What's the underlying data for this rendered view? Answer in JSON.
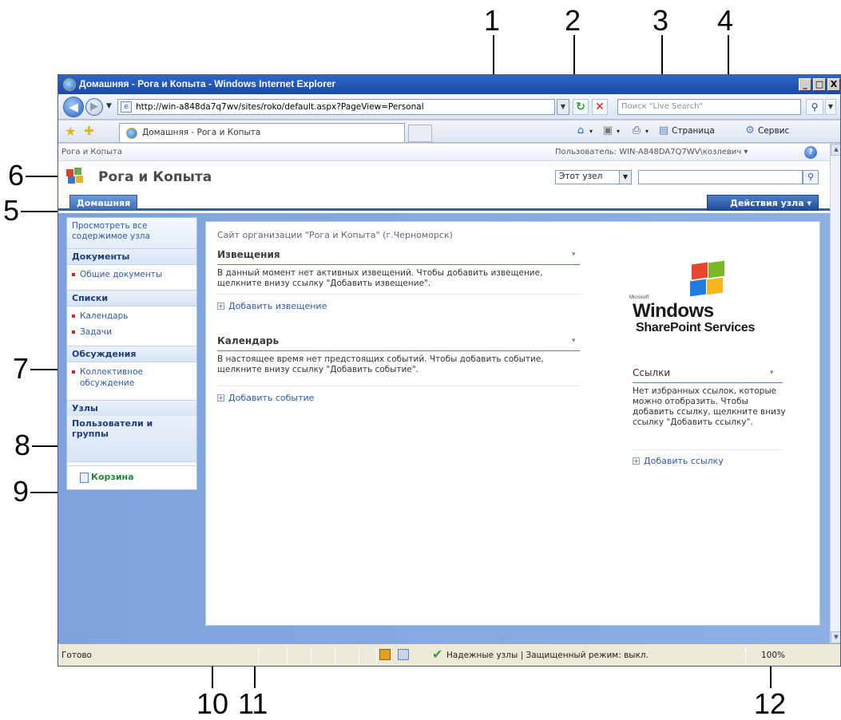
{
  "callouts": [
    "1",
    "2",
    "3",
    "4",
    "5",
    "6",
    "7",
    "8",
    "9",
    "10",
    "11",
    "12"
  ],
  "window": {
    "title": "Домашняя - Рога и Копыта - Windows Internet Explorer",
    "min_label": "_",
    "max_label": "□",
    "close_label": "X"
  },
  "address": {
    "url": "http://win-a848da7q7wv/sites/roko/default.aspx?PageView=Personal",
    "search_placeholder": "Поиск \"Live Search\""
  },
  "tabs": {
    "active_tab": "Домашняя - Рога и Копыта"
  },
  "commands": {
    "page": "Страница",
    "tools": "Сервис"
  },
  "sharepoint": {
    "breadcrumb": "Рога и Копыта",
    "user_label": "Пользователь: WIN-A848DA7Q7WV\\козлевич ▾",
    "site_title": "Рога и Копыта",
    "scope": "Этот узел",
    "home_tab": "Домашняя",
    "site_actions": "Действия узла ▾"
  },
  "quicklaunch": {
    "view_all": "Просмотреть все содержимое узла",
    "documents_header": "Документы",
    "shared_docs": "Общие документы",
    "lists_header": "Списки",
    "calendar": "Календарь",
    "tasks": "Задачи",
    "discussions_header": "Обсуждения",
    "team_discussion": "Коллективное обсуждение",
    "sites_header": "Узлы",
    "people_header": "Пользователи и группы",
    "recycle_bin": "Корзина"
  },
  "main": {
    "site_description": "Сайт организации \"Рога и Копыта\" (г.Черноморск)",
    "announcements": {
      "title": "Извещения",
      "body": "В данный момент нет активных извещений. Чтобы добавить извещение, щелкните внизу ссылку \"Добавить извещение\".",
      "add_link": "Добавить извещение"
    },
    "calendar": {
      "title": "Календарь",
      "body": "В настоящее время нет предстоящих событий. Чтобы добавить событие, щелкните внизу ссылку \"Добавить событие\".",
      "add_link": "Добавить событие"
    },
    "links": {
      "title": "Ссылки",
      "body": "Нет избранных ссылок, которые можно отобразить. Чтобы добавить ссылку, щелкните внизу ссылку \"Добавить ссылку\".",
      "add_link": "Добавить ссылку"
    },
    "wss_logo": {
      "microsoft": "Microsoft",
      "windows": "Windows",
      "sharepoint": "SharePoint Services"
    },
    "webpart_menu_glyph": "▾"
  },
  "statusbar": {
    "status": "Готово",
    "zone": "Надежные узлы | Защищенный режим: выкл.",
    "zoom": "100%"
  }
}
